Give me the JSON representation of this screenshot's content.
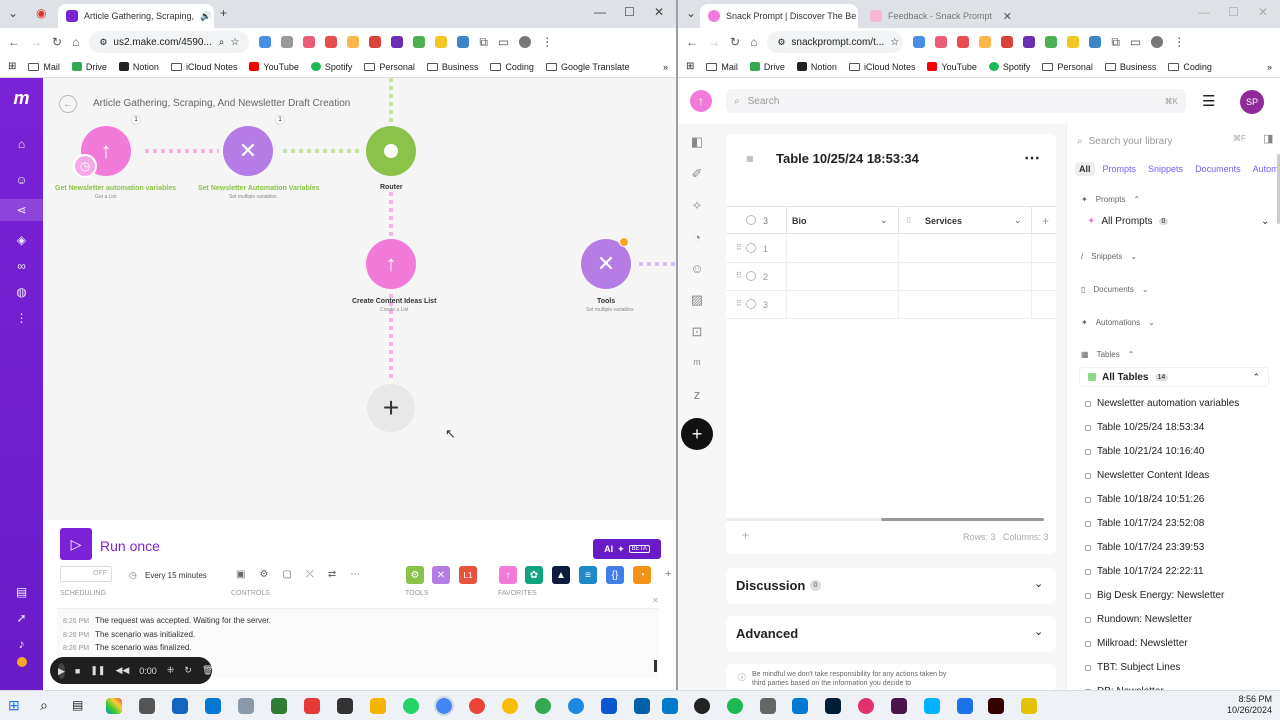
{
  "left_browser": {
    "tab_title": "Article Gathering, Scraping,",
    "address": "us2.make.com/4590...",
    "bookmarks": [
      "Mail",
      "Drive",
      "Notion",
      "iCloud Notes",
      "YouTube",
      "Spotify",
      "Personal",
      "Business",
      "Coding",
      "Google Translate"
    ]
  },
  "make": {
    "scenario_title": "Article Gathering, Scraping, And Newsletter Draft Creation",
    "nodes": [
      {
        "label": "Get Newsletter automation variables",
        "sub": "Get a List",
        "color": "#f27ad8"
      },
      {
        "label": "Set Newsletter Automation Variables",
        "sub": "Set multiple variables",
        "color": "#b57ce6"
      },
      {
        "label": "Router",
        "sub": "",
        "color": "#8bc34a"
      },
      {
        "label": "Create Content Ideas List",
        "sub": "Create a List",
        "color": "#f27ad8"
      },
      {
        "label": "Tools",
        "sub": "Set multiple variables",
        "color": "#b57ce6"
      }
    ],
    "bubbles": [
      "1",
      "1"
    ],
    "run_once": "Run once",
    "toggle": "OFF",
    "schedule": "Every 15 minutes",
    "ai_label": "AI",
    "beta": "BETA",
    "groups": {
      "scheduling": "SCHEDULING",
      "controls": "CONTROLS",
      "tools": "TOOLS",
      "favorites": "FAVORITES"
    },
    "tool_L1": "L1",
    "logs": [
      {
        "time": "8:26 PM",
        "text": "The request was accepted. Waiting for the server."
      },
      {
        "time": "8:26 PM",
        "text": "The scenario was initialized."
      },
      {
        "time": "8:26 PM",
        "text": "The scenario was finalized."
      }
    ],
    "recorder_time": "0:00"
  },
  "right_browser": {
    "tab1_title": "Snack Prompt | Discover The Be",
    "tab2_title": "Feedback - Snack Prompt",
    "address": "snackprompt.com/t...",
    "bookmarks": [
      "Mail",
      "Drive",
      "Notion",
      "iCloud Notes",
      "YouTube",
      "Spotify",
      "Personal",
      "Business",
      "Coding"
    ]
  },
  "snack": {
    "search_placeholder": "Search",
    "search_shortcut": "⌘K",
    "avatar": "SP",
    "table_title": "Table 10/25/24 18:53:34",
    "col_count": "3",
    "columns": [
      "Bio",
      "Services"
    ],
    "rows": [
      "1",
      "2",
      "3"
    ],
    "footer_stats": "Rows: 3   Columns: 3",
    "discussion": "Discussion",
    "discussion_count": "0",
    "advanced": "Advanced",
    "disclaimer": "Be mindful we don't take responsibility for any actions taken by third parties based on the information you decide to",
    "library_search": "Search your library",
    "library_shortcut": "⌘F",
    "filters": [
      "All",
      "Prompts",
      "Snippets",
      "Documents",
      "Autom"
    ],
    "sections": {
      "prompts": "Prompts",
      "all_prompts": "All Prompts",
      "all_prompts_count": "0",
      "snippets": "Snippets",
      "documents": "Documents",
      "automations": "Automations",
      "tables": "Tables",
      "all_tables": "All Tables",
      "all_tables_count": "14"
    },
    "tables": [
      "Newsletter automation variables",
      "Table 10/25/24 18:53:34",
      "Table 10/21/24 10:16:40",
      "Newsletter Content Ideas",
      "Table 10/18/24 10:51:26",
      "Table 10/17/24 23:52:08",
      "Table 10/17/24 23:39:53",
      "Table 10/17/24 22:22:11",
      "Big Desk Energy: Newsletter",
      "Rundown: Newsletter",
      "Milkroad: Newsletter",
      "TBT: Subject Lines",
      "DB: Newsletter"
    ]
  },
  "taskbar": {
    "time": "8:56 PM",
    "date": "10/26/2024"
  }
}
